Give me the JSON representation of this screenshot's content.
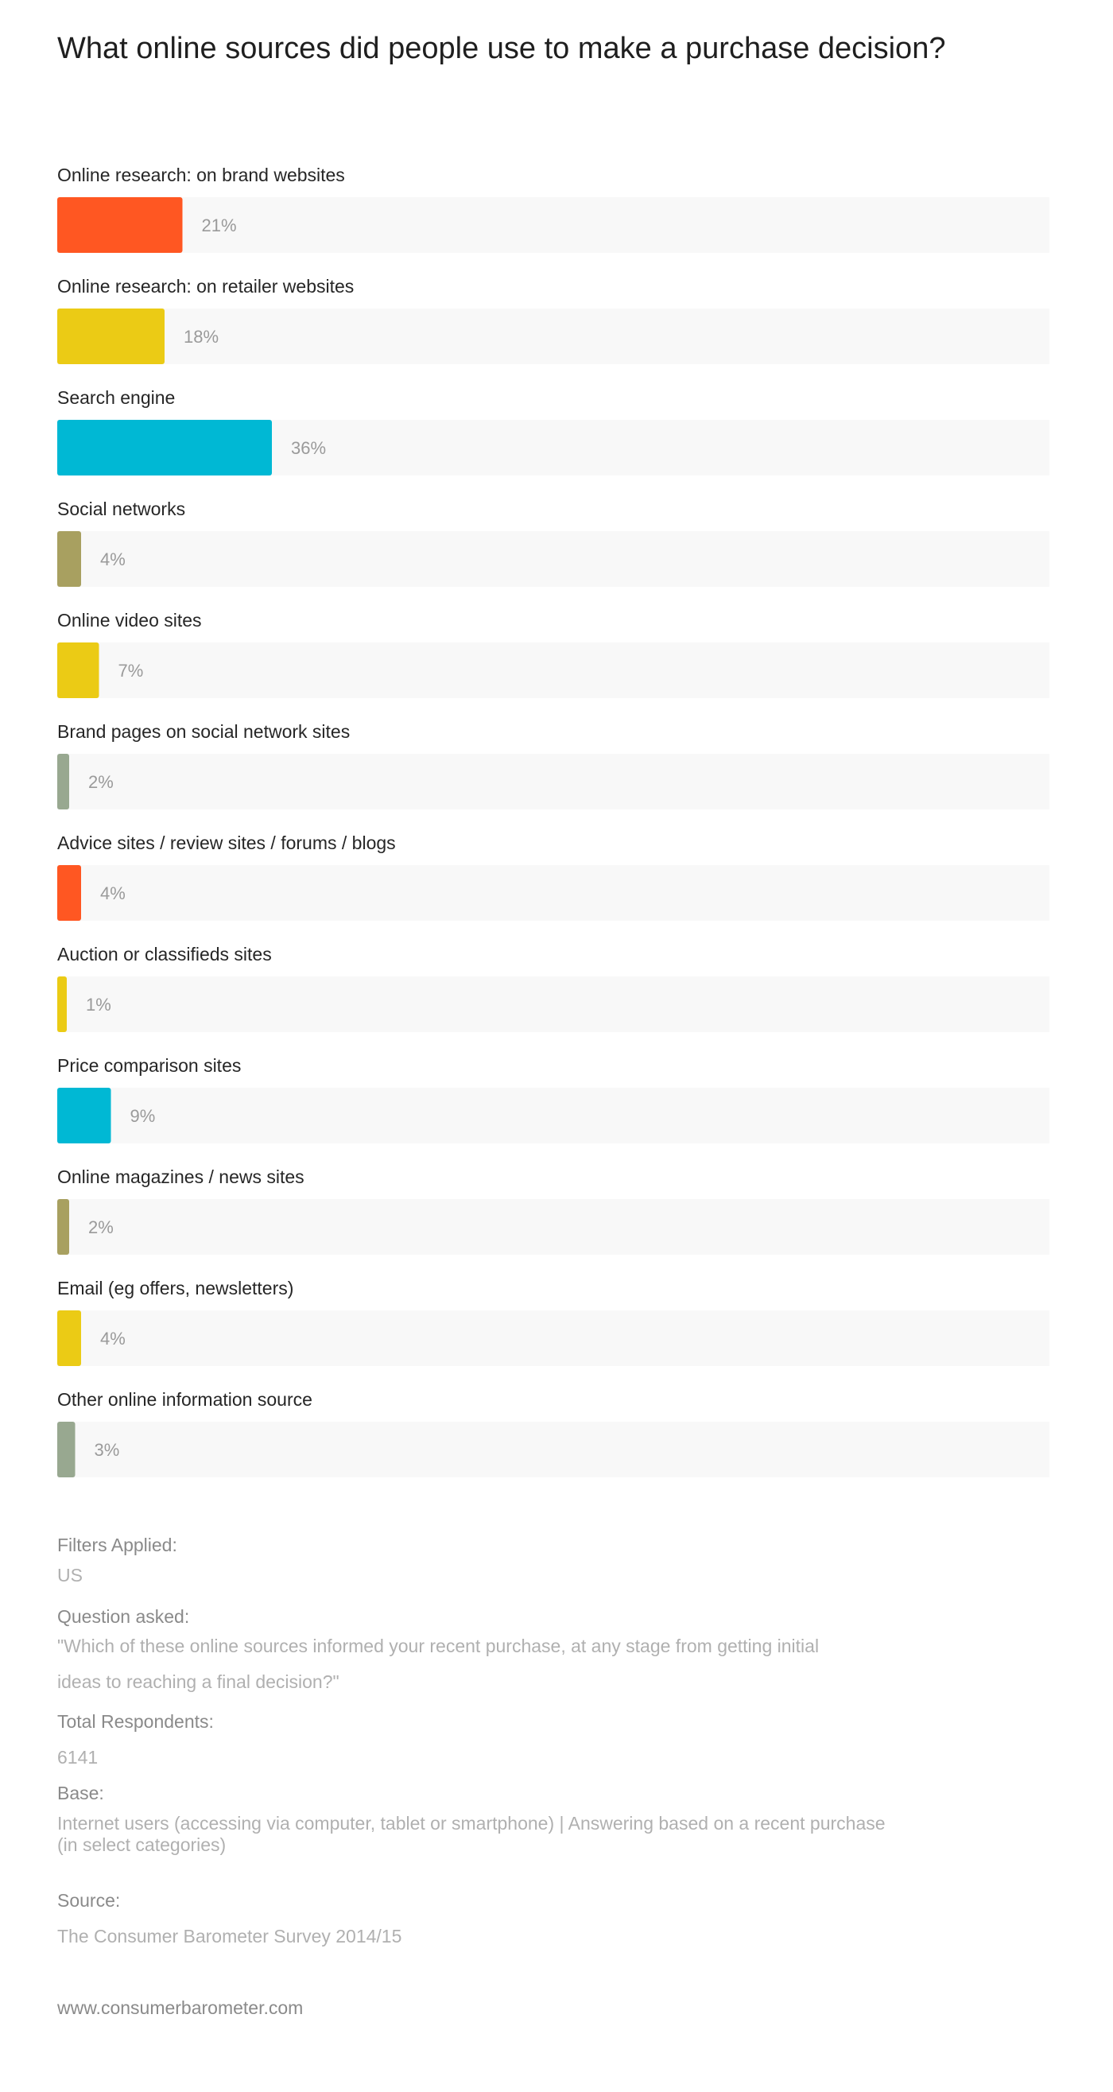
{
  "title": "What online sources did people use to make a purchase decision?",
  "chart_data": {
    "type": "bar",
    "orientation": "horizontal",
    "title": "What online sources did people use to make a purchase decision?",
    "categories": [
      "Online research: on brand websites",
      "Online research: on retailer websites",
      "Search engine",
      "Social networks",
      "Online video sites",
      "Brand pages on social network sites",
      "Advice sites / review sites / forums / blogs",
      "Auction or classifieds sites",
      "Price comparison sites",
      "Online magazines / news sites",
      "Email (eg offers, newsletters)",
      "Other online information source"
    ],
    "values": [
      21,
      18,
      36,
      4,
      7,
      2,
      4,
      1,
      9,
      2,
      4,
      3
    ],
    "value_labels": [
      "21%",
      "18%",
      "36%",
      "4%",
      "7%",
      "2%",
      "4%",
      "1%",
      "9%",
      "2%",
      "4%",
      "3%"
    ],
    "colors": [
      "#ff5722",
      "#ebcb15",
      "#00b8d4",
      "#a8a060",
      "#ebcb15",
      "#98a890",
      "#ff5722",
      "#ebcb15",
      "#00b8d4",
      "#a8a060",
      "#ebcb15",
      "#98a890"
    ],
    "track_color": "#f8f8f8",
    "xlim": [
      0,
      100
    ],
    "grid": false
  },
  "filters": {
    "heading": "Filters Applied:",
    "value": "US"
  },
  "question": {
    "heading": "Question asked:",
    "line1": "\"Which of these online sources informed your recent purchase, at any stage from getting initial",
    "line2": "ideas to reaching a final decision?\""
  },
  "respondents": {
    "heading": "Total Respondents:",
    "value": "6141"
  },
  "base": {
    "heading": "Base:",
    "line1": "Internet users (accessing via computer, tablet or smartphone) | Answering based on a recent purchase",
    "line2": "(in select categories)"
  },
  "source": {
    "heading": "Source:",
    "value": "The Consumer Barometer Survey 2014/15"
  },
  "footer": {
    "url": "www.consumerbarometer.com"
  }
}
